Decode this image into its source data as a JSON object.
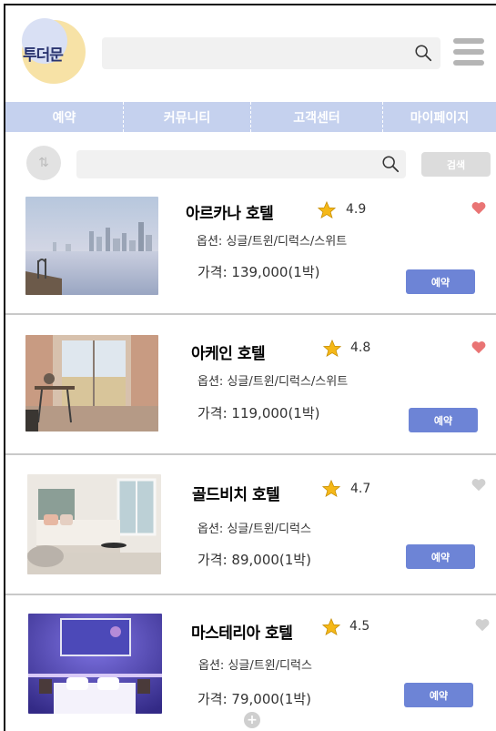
{
  "brand": {
    "logo_text": "투더문"
  },
  "search": {
    "placeholder": "",
    "sub_placeholder": "",
    "button_label": "검색"
  },
  "nav": {
    "items": [
      "예약",
      "커뮤니티",
      "고객센터",
      "마이페이지"
    ]
  },
  "colors": {
    "nav_bg": "#c5d1ee",
    "accent": "#6d84d6",
    "heart_on": "#e97474",
    "heart_off": "#d0d0d0",
    "star": "#f5b818"
  },
  "hotels": [
    {
      "name": "아르카나 호텔",
      "rating": "4.9",
      "options": "옵션: 싱글/트윈/디럭스/스위트",
      "price": "가격: 139,000(1박)",
      "book_label": "예약",
      "favorite": true
    },
    {
      "name": "아케인 호텔",
      "rating": "4.8",
      "options": "옵션: 싱글/트윈/디럭스/스위트",
      "price": "가격: 119,000(1박)",
      "book_label": "예약",
      "favorite": true
    },
    {
      "name": "골드비치 호텔",
      "rating": "4.7",
      "options": "옵션: 싱글/트윈/디럭스",
      "price": "가격: 89,000(1박)",
      "book_label": "예약",
      "favorite": false
    },
    {
      "name": "마스테리아 호텔",
      "rating": "4.5",
      "options": "옵션: 싱글/트윈/디럭스",
      "price": "가격: 79,000(1박)",
      "book_label": "예약",
      "favorite": false
    }
  ],
  "icons": {
    "search": "search-icon",
    "menu": "hamburger-menu-icon",
    "star": "star-icon",
    "heart": "heart-icon",
    "more": "plus-icon",
    "filter": "filter-icon"
  },
  "more": {
    "label": "+"
  }
}
